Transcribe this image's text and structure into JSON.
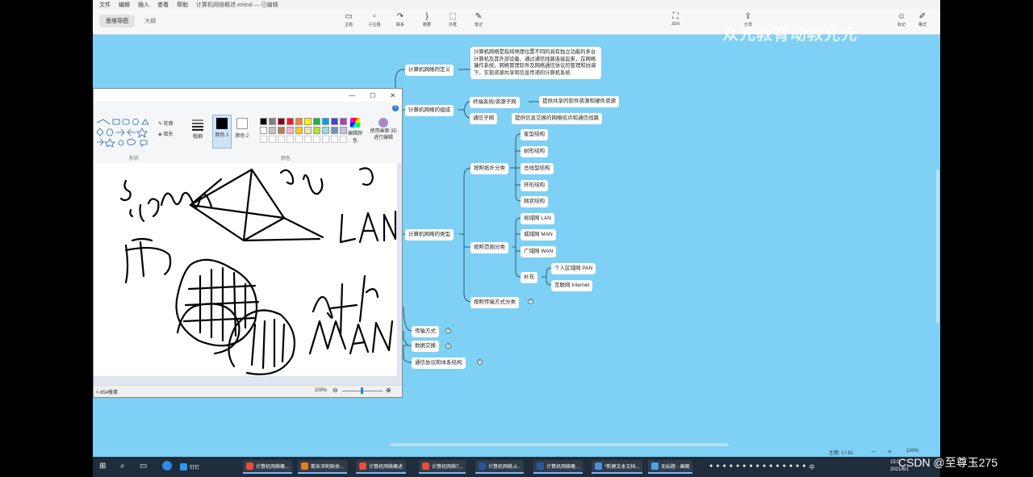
{
  "menu": [
    "文件",
    "编辑",
    "插入",
    "查看",
    "帮助"
  ],
  "doc_title": "计算机网络概述.xmind — 已编辑",
  "view_tabs": [
    "思维导图",
    "大纲"
  ],
  "toolbar": [
    {
      "label": "主题",
      "icon": "topic-icon"
    },
    {
      "label": "子主题",
      "icon": "subtopic-icon"
    },
    {
      "label": "联系",
      "icon": "relationship-icon"
    },
    {
      "label": "概要",
      "icon": "summary-icon"
    },
    {
      "label": "外框",
      "icon": "boundary-icon"
    },
    {
      "label": "笔记",
      "icon": "notes-icon"
    },
    {
      "label": "ZEN",
      "icon": "zen-icon"
    },
    {
      "label": "分享",
      "icon": "share-icon"
    },
    {
      "label": "标记",
      "icon": "marker-icon"
    },
    {
      "label": "格式",
      "icon": "format-icon"
    }
  ],
  "watermark": "众元教育动教光元",
  "mindmap": {
    "definition": {
      "label": "计算机网络的定义",
      "text": "计算机网络是指将地理位置不同的具有独立功能的多台计算机及其外部设备，通过通信线路连接起来，在网络操作系统，网络管理软件及网络通信协议的管理和协调下，实现资源共享和信息传递的计算机系统"
    },
    "composition": {
      "label": "计算机网络的组成",
      "children": [
        {
          "label": "终端系统/资源子网",
          "desc": "提供共享的软件资源和硬件资源"
        },
        {
          "label": "通信子网",
          "desc": "提供信息交换的网络结点和通信线路"
        }
      ]
    },
    "types": {
      "label": "计算机网络的类型",
      "topology": {
        "label": "按照拓扑分类",
        "items": [
          "星型结构",
          "树形结构",
          "总线型结构",
          "环形结构",
          "网状结构"
        ]
      },
      "range": {
        "label": "按照范围分类",
        "items": [
          "局域网 LAN",
          "城域网 MAN",
          "广域网 WAN"
        ],
        "supplement": {
          "label": "补充",
          "items": [
            "个人区域网 PAN",
            "互联网 Internet"
          ]
        }
      },
      "transmission": {
        "label": "按照传输方式分类"
      }
    },
    "others": [
      "传输方式",
      "数据交换",
      "通信协议和体系结构"
    ]
  },
  "statusbar": {
    "topic": "主题: 1 / 81",
    "zoom": "100%"
  },
  "paint": {
    "shape_group": "形状",
    "color_group": "颜色",
    "outline": "轮廓",
    "fill": "填充",
    "thickness": "粗细",
    "color1": "颜色 1",
    "color2": "颜色 2",
    "edit_colors": "编辑颜色",
    "paint3d": "使用画图 3D 进行编辑",
    "size": "× 854像素",
    "zoom": "100%",
    "palette": [
      "#000000",
      "#7f7f7f",
      "#880015",
      "#ed1c24",
      "#ff7f27",
      "#fff200",
      "#22b14c",
      "#00a2e8",
      "#3f48cc",
      "#a349a4",
      "#ffffff",
      "#c3c3c3",
      "#b97a57",
      "#ffaec9",
      "#ffc90e",
      "#efe4b0",
      "#b5e61d",
      "#99d9ea",
      "#7092be",
      "#c8bfe7"
    ]
  },
  "taskbar": {
    "items": [
      {
        "label": "钉钉",
        "color": "#3296fa"
      },
      {
        "label": "计算机网络概...",
        "color": "#e74c3c"
      },
      {
        "label": "期末冲刺政体...",
        "color": "#e67e22"
      },
      {
        "label": "计算机网络概述",
        "color": "#e74c3c"
      },
      {
        "label": "计算机网络7...",
        "color": "#e74c3c"
      },
      {
        "label": "计算机网络.d...",
        "color": "#2b579a"
      },
      {
        "label": "计算机网络概...",
        "color": "#2b579a"
      },
      {
        "label": "*新建文本文档...",
        "color": "#4a90d9"
      },
      {
        "label": "无标题 - 画图",
        "color": "#4aa3df"
      }
    ],
    "time": "15:0",
    "date": "2021/6/1",
    "tray": "中"
  },
  "credit": "CSDN @至尊玉275"
}
